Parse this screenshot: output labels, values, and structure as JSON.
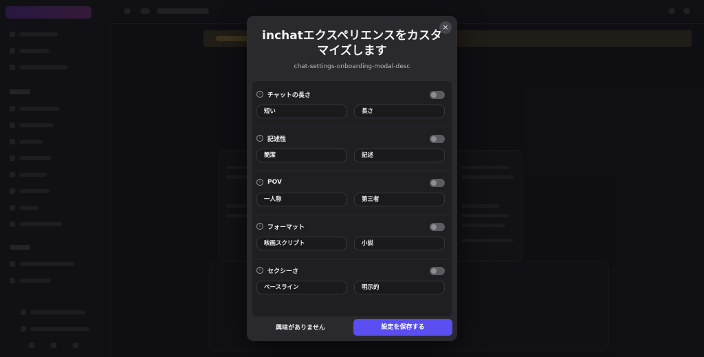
{
  "modal": {
    "title": "inchatエクスペリエンスをカスタマイズします",
    "description": "chat-settings-onboarding-modal-desc",
    "close_glyph": "×",
    "sections": [
      {
        "label": "チャットの長さ",
        "option_a": "短い",
        "option_b": "長さ",
        "enabled": false
      },
      {
        "label": "記述性",
        "option_a": "簡潔",
        "option_b": "記述",
        "enabled": false
      },
      {
        "label": "POV",
        "option_a": "一人称",
        "option_b": "第三者",
        "enabled": false
      },
      {
        "label": "フォーマット",
        "option_a": "映画スクリプト",
        "option_b": "小説",
        "enabled": false
      },
      {
        "label": "セクシーさ",
        "option_a": "ベースライン",
        "option_b": "明示的",
        "enabled": false
      }
    ],
    "info_glyph": "i",
    "not_interested_label": "興味がありません",
    "save_label": "設定を保存する"
  },
  "colors": {
    "accent": "#5b4ef0",
    "modal_bg": "#2a2a2e",
    "panel_bg": "#1f1f22"
  }
}
